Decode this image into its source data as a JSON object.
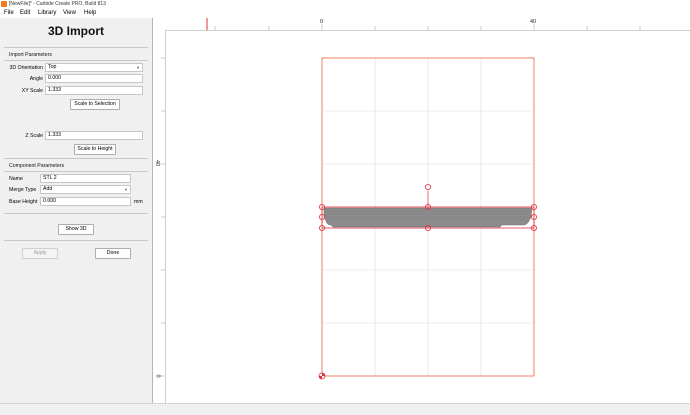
{
  "window": {
    "title": "[NewFile]* - Carbide Create PRO, Build 813"
  },
  "menu": [
    "File",
    "Edit",
    "Library",
    "View",
    "Help"
  ],
  "panel": {
    "title": "3D Import",
    "import_section": "Import Parameters",
    "orientation_label": "3D Orientation",
    "orientation_value": "Top",
    "angle_label": "Angle",
    "angle_value": "0.000",
    "xy_scale_label": "XY Scale",
    "xy_scale_value": "1.333",
    "scale_to_selection": "Scale to Selection",
    "z_scale_label": "Z Scale",
    "z_scale_value": "1.333",
    "scale_to_height": "Scale to Height",
    "component_section": "Component Parameters",
    "name_label": "Name",
    "name_value": "STL 2",
    "merge_label": "Merge Type",
    "merge_value": "Add",
    "base_height_label": "Base Height",
    "base_height_value": "0.000",
    "base_height_unit": "mm",
    "show_3d": "Show 3D",
    "apply": "Apply",
    "done": "Done"
  },
  "ruler": {
    "h_labels": [
      "0",
      "40"
    ],
    "v_labels": [
      "40",
      "0"
    ]
  },
  "colors": {
    "stock_outline": "#e8643c",
    "selection": "#e0313e",
    "model_fill": "#8c8c8c",
    "grid": "#dcdcdc"
  }
}
